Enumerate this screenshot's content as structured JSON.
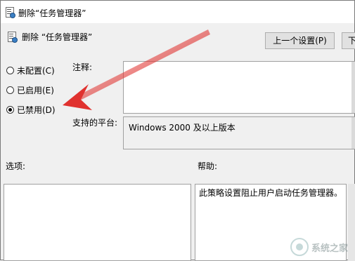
{
  "window": {
    "title": "删除“任务管理器”",
    "icon": "policy-settings-icon"
  },
  "header": {
    "title": "删除 “任务管理器”",
    "prev_button": "上一个设置(P)",
    "next_button": "下"
  },
  "radios": [
    {
      "label": "未配置(C)",
      "selected": false
    },
    {
      "label": "已启用(E)",
      "selected": false
    },
    {
      "label": "已禁用(D)",
      "selected": true
    }
  ],
  "comment": {
    "label": "注释:",
    "value": ""
  },
  "platform": {
    "label": "支持的平台:",
    "value": "Windows 2000 及以上版本"
  },
  "options": {
    "label": "选项:"
  },
  "help": {
    "label": "帮助:",
    "text": "此策略设置阻止用户启动任务管理器。"
  },
  "annotation": {
    "arrow_color": "#e0322f"
  },
  "watermark": {
    "text": "系统之家"
  }
}
